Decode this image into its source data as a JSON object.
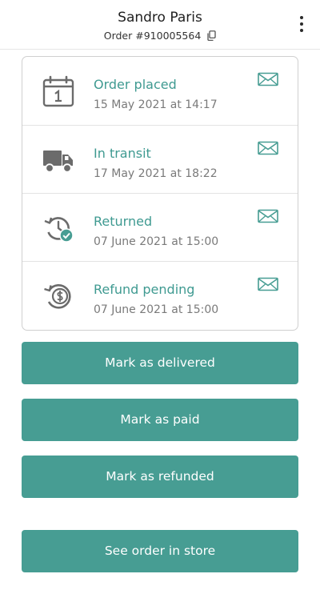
{
  "header": {
    "title": "Sandro Paris",
    "order_label": "Order #910005564",
    "icons": {
      "copy": "copy-icon",
      "menu": "more-vertical-icon"
    }
  },
  "timeline": [
    {
      "label": "Order placed",
      "date": "15 May 2021 at 14:17",
      "icon": "calendar-icon"
    },
    {
      "label": "In transit",
      "date": "17 May 2021 at 18:22",
      "icon": "truck-icon"
    },
    {
      "label": "Returned",
      "date": "07 June 2021 at 15:00",
      "icon": "history-check-icon"
    },
    {
      "label": "Refund pending",
      "date": "07 June 2021 at 15:00",
      "icon": "refund-dollar-icon"
    }
  ],
  "actions": {
    "mark_delivered": "Mark as delivered",
    "mark_paid": "Mark as paid",
    "mark_refunded": "Mark as refunded",
    "see_in_store": "See order in store"
  },
  "colors": {
    "accent": "#479d93",
    "accent_text": "#3f9a91",
    "icon_gray": "#6b6b6b",
    "date_text": "#7a7a7a"
  }
}
